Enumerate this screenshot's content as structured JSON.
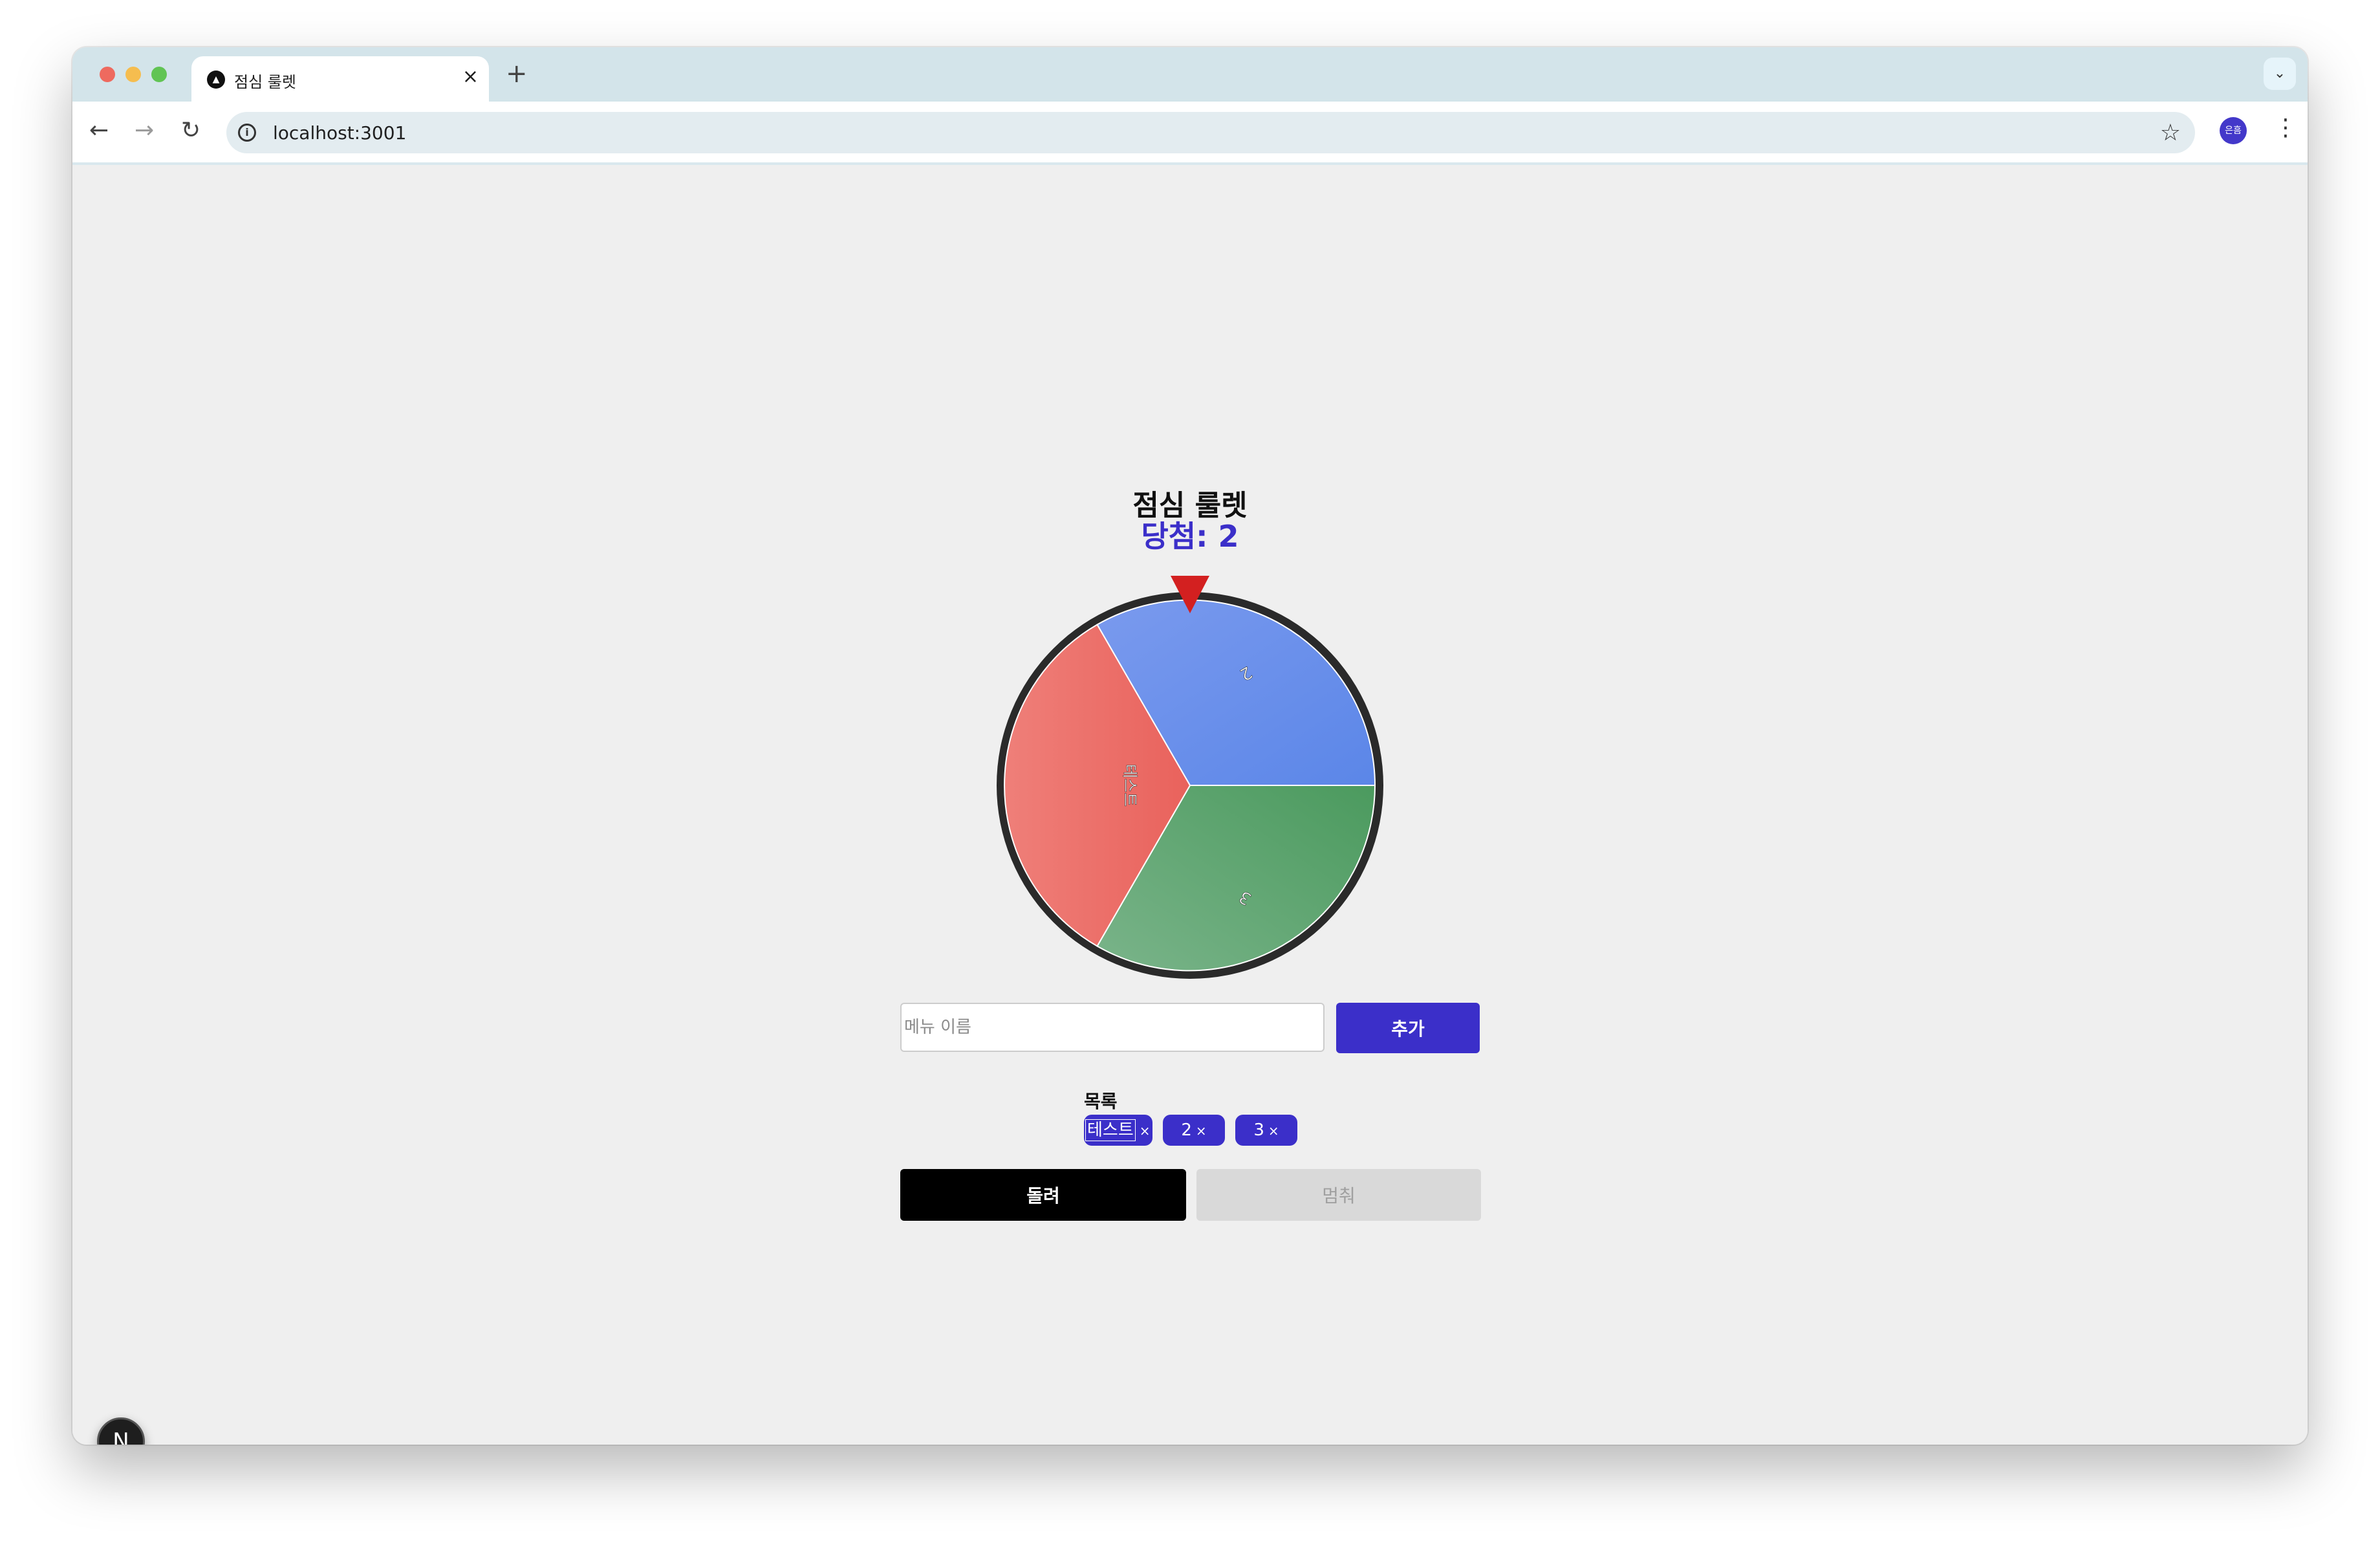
{
  "browser": {
    "tab_title": "점심 룰렛",
    "tab_close": "×",
    "new_tab": "+",
    "tabs_dropdown": "⌄",
    "url": "localhost:3001",
    "profile_initials": "은흠",
    "icons": [
      "back-arrow-icon",
      "forward-arrow-icon",
      "reload-icon",
      "site-info-icon",
      "star-icon",
      "kebab-menu-icon"
    ]
  },
  "app": {
    "title": "점심 룰렛",
    "winner_label": "당첨: 2",
    "input_placeholder": "메뉴 이름",
    "add_button": "추가",
    "list_label": "목록",
    "items": [
      {
        "label": "테스트",
        "remove": "×"
      },
      {
        "label": "2",
        "remove": "×"
      },
      {
        "label": "3",
        "remove": "×"
      }
    ],
    "spin_button": "돌려",
    "stop_button": "멈춰"
  },
  "wheel": {
    "segments": [
      {
        "label": "2",
        "color": "#6b90ec"
      },
      {
        "label": "3",
        "color": "#5ea86f"
      },
      {
        "label": "테스트",
        "color": "#ec6d68"
      }
    ],
    "pointer_color": "#d32020",
    "border_color": "#2a2a2a"
  },
  "next_badge": "N"
}
